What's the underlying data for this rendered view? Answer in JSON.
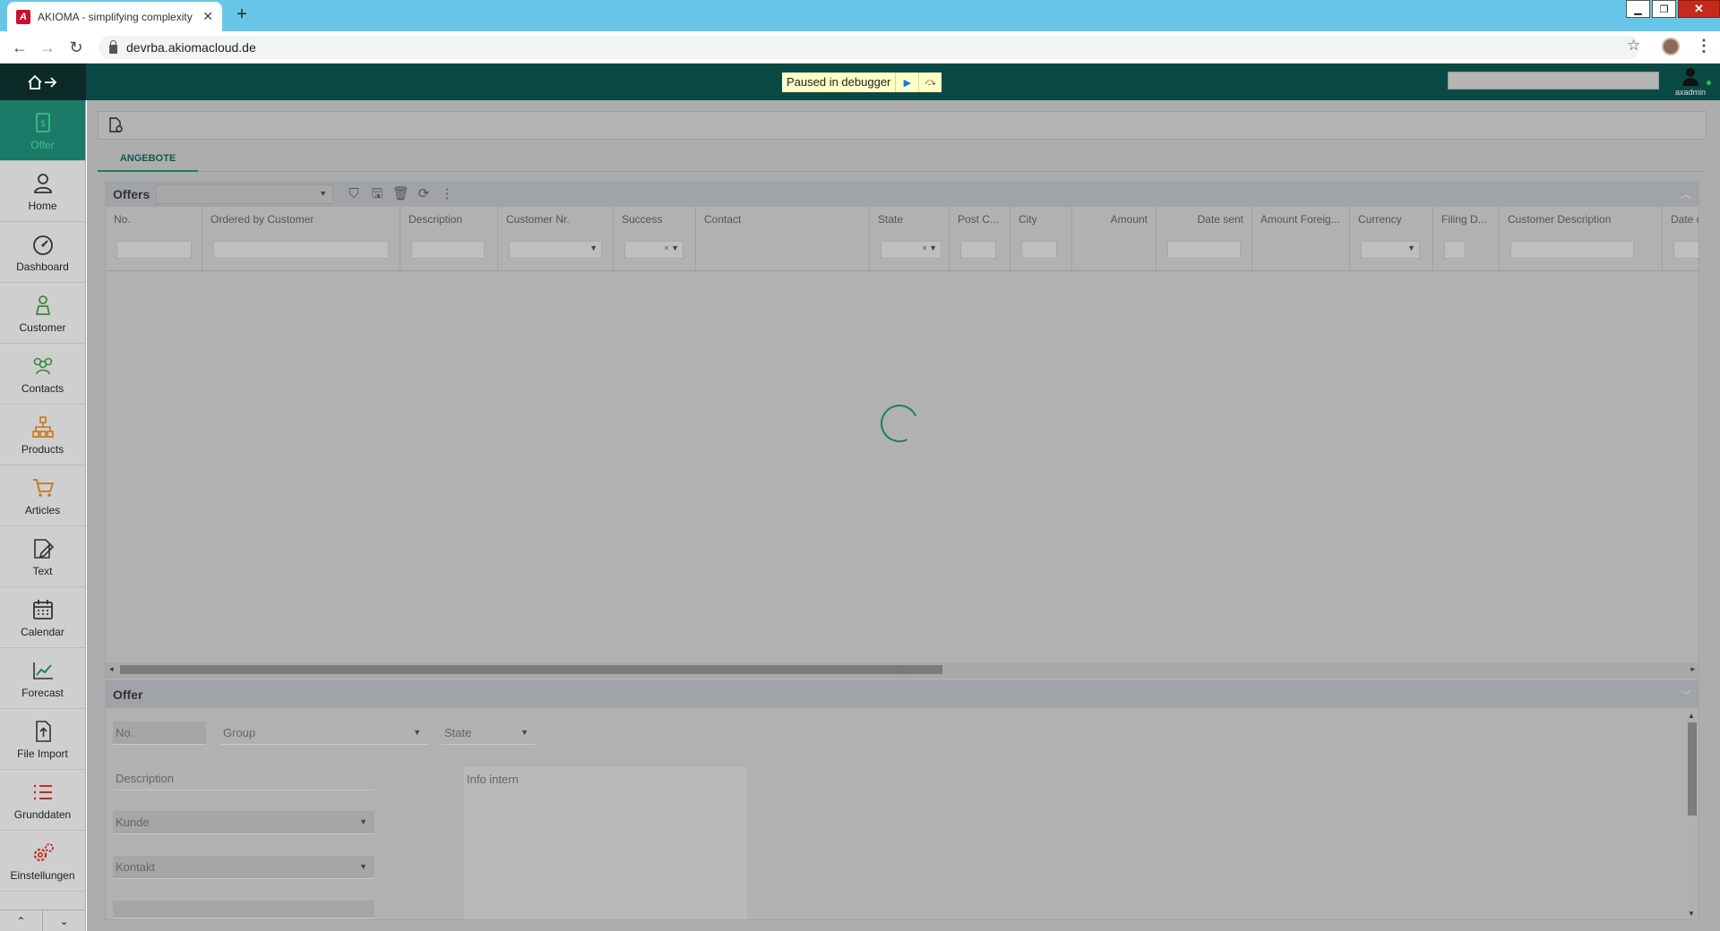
{
  "browser": {
    "tab_title": "AKIOMA - simplifying complexity",
    "url": "devrba.akiomacloud.de"
  },
  "header": {
    "debugger_label": "Paused in debugger",
    "user_name": "axadmin"
  },
  "sidebar": {
    "items": [
      {
        "label": "Offer",
        "icon": "offer-icon",
        "color": "#3bbf8a"
      },
      {
        "label": "Home",
        "icon": "home-icon",
        "color": "#333333"
      },
      {
        "label": "Dashboard",
        "icon": "dashboard-icon",
        "color": "#333333"
      },
      {
        "label": "Customer",
        "icon": "customer-icon",
        "color": "#3a8a3a"
      },
      {
        "label": "Contacts",
        "icon": "contacts-icon",
        "color": "#3a8a3a"
      },
      {
        "label": "Products",
        "icon": "products-icon",
        "color": "#c8741c"
      },
      {
        "label": "Articles",
        "icon": "cart-icon",
        "color": "#c8741c"
      },
      {
        "label": "Text",
        "icon": "text-edit-icon",
        "color": "#333333"
      },
      {
        "label": "Calendar",
        "icon": "calendar-icon",
        "color": "#333333"
      },
      {
        "label": "Forecast",
        "icon": "forecast-icon",
        "color": "#1c7a68"
      },
      {
        "label": "File Import",
        "icon": "file-import-icon",
        "color": "#333333"
      },
      {
        "label": "Grunddaten",
        "icon": "list-icon",
        "color": "#c42b1c"
      },
      {
        "label": "Einstellungen",
        "icon": "settings-icon",
        "color": "#c42b1c"
      }
    ]
  },
  "module": {
    "tab_label": "ANGEBOTE"
  },
  "grid": {
    "title": "Offers",
    "columns": [
      "No.",
      "Ordered by Customer",
      "Description",
      "Customer Nr.",
      "Success",
      "Contact",
      "State",
      "Post C...",
      "City",
      "Amount",
      "Date sent",
      "Amount Foreig...",
      "Currency",
      "Filing D...",
      "Customer Description",
      "Date cr"
    ]
  },
  "detail": {
    "title": "Offer",
    "fields": {
      "no_label": "No.",
      "group_label": "Group",
      "state_label": "State",
      "description_label": "Description",
      "info_intern_label": "Info intern",
      "kunde_label": "Kunde",
      "kontakt_label": "Kontakt"
    }
  },
  "colors": {
    "accent": "#1c7a68",
    "header_bg": "#0a4a45",
    "overlay": "#adadad"
  }
}
